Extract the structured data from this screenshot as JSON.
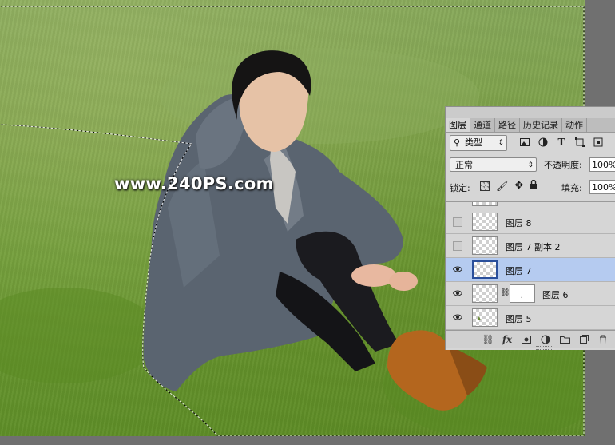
{
  "watermark": "www.240PS.com",
  "layers_panel": {
    "tabs": [
      "图层",
      "通道",
      "路径",
      "历史记录",
      "动作"
    ],
    "filter": {
      "label": "类型",
      "icons": [
        "image-filter-icon",
        "adjustment-filter-icon",
        "type-filter-icon",
        "shape-filter-icon",
        "smart-object-filter-icon"
      ]
    },
    "blend_mode": "正常",
    "opacity_label": "不透明度:",
    "opacity_value": "100%",
    "lock_label": "锁定:",
    "fill_label": "填充:",
    "fill_value": "100%",
    "layers": [
      {
        "name": "图层 8",
        "visible": false,
        "selected": false,
        "mask": false
      },
      {
        "name": "图层 7 副本 2",
        "visible": false,
        "selected": false,
        "mask": false
      },
      {
        "name": "图层 7",
        "visible": true,
        "selected": true,
        "mask": false
      },
      {
        "name": "图层 6",
        "visible": true,
        "selected": false,
        "mask": true
      },
      {
        "name": "图层 5",
        "visible": true,
        "selected": false,
        "mask": false
      }
    ],
    "bottom_icons": [
      "link-layers-icon",
      "fx-icon",
      "add-mask-icon",
      "adjustment-layer-icon",
      "new-group-icon",
      "new-layer-icon",
      "delete-layer-icon"
    ],
    "fx_label": "fx"
  },
  "colors": {
    "selected_layer": "#b5cbf0",
    "panel_bg": "#d6d6d6"
  }
}
